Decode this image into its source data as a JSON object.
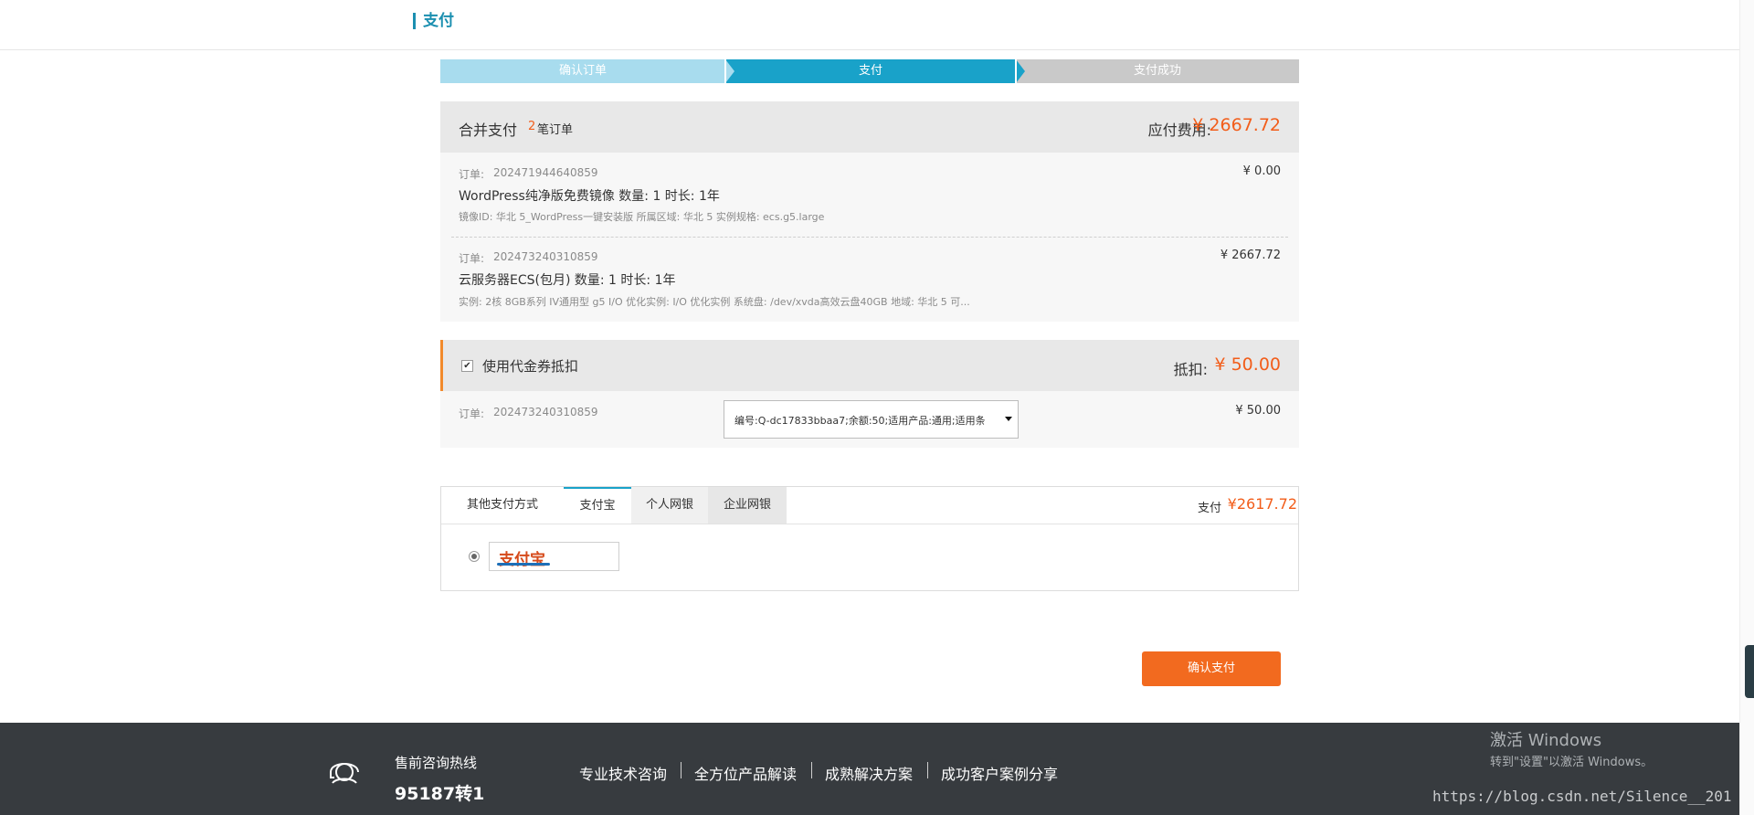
{
  "header": {
    "title": "支付"
  },
  "steps": [
    {
      "label": "确认订单"
    },
    {
      "label": "支付"
    },
    {
      "label": "支付成功"
    }
  ],
  "merge": {
    "title": "合并支付",
    "count": "2",
    "count_suffix": "笔订单",
    "fee_label": "应付费用:",
    "fee_value": "¥ 2667.72"
  },
  "orders": [
    {
      "id_label": "订单:",
      "id": "202471944640859",
      "title": "WordPress纯净版免费镜像 数量: 1 时长: 1年",
      "detail": "镜像ID: 华北 5_WordPress一键安装版 所属区域: 华北 5 实例规格: ecs.g5.large",
      "price": "¥ 0.00"
    },
    {
      "id_label": "订单:",
      "id": "202473240310859",
      "title": "云服务器ECS(包月) 数量: 1 时长: 1年",
      "detail": "实例: 2核 8GB系列 IV通用型 g5 I/O 优化实例: I/O 优化实例 系统盘: /dev/xvda高效云盘40GB 地域: 华北 5 可...",
      "price": "¥ 2667.72"
    }
  ],
  "voucher": {
    "title": "使用代金券抵扣",
    "deduct_label": "抵扣:",
    "deduct_value": "¥ 50.00",
    "order_label": "订单:",
    "order_id": "202473240310859",
    "select_value": "编号:Q-dc17833bbaa7;余额:50;适用产品:通用;适用条",
    "price": "¥ 50.00"
  },
  "payment": {
    "tabs": [
      "其他支付方式",
      "支付宝",
      "个人网银",
      "企业网银"
    ],
    "active_tab": "支付宝",
    "pay_label": "支付",
    "pay_value": "¥2617.72",
    "alipay_logo": "支付宝"
  },
  "confirm_button": "确认支付",
  "footer": {
    "hotline_label": "售前咨询热线",
    "hotline_number": "95187转1",
    "links": [
      "专业技术咨询",
      "全方位产品解读",
      "成熟解决方案",
      "成功客户案例分享"
    ]
  },
  "watermark": {
    "activate_title": "激活 Windows",
    "activate_sub": "转到\"设置\"以激活 Windows。",
    "url": "https://blog.csdn.net/Silence__201"
  },
  "colors": {
    "accent": "#19a2c9",
    "price": "#f25d1a",
    "button": "#f26a1f",
    "footer": "#373b3f"
  }
}
